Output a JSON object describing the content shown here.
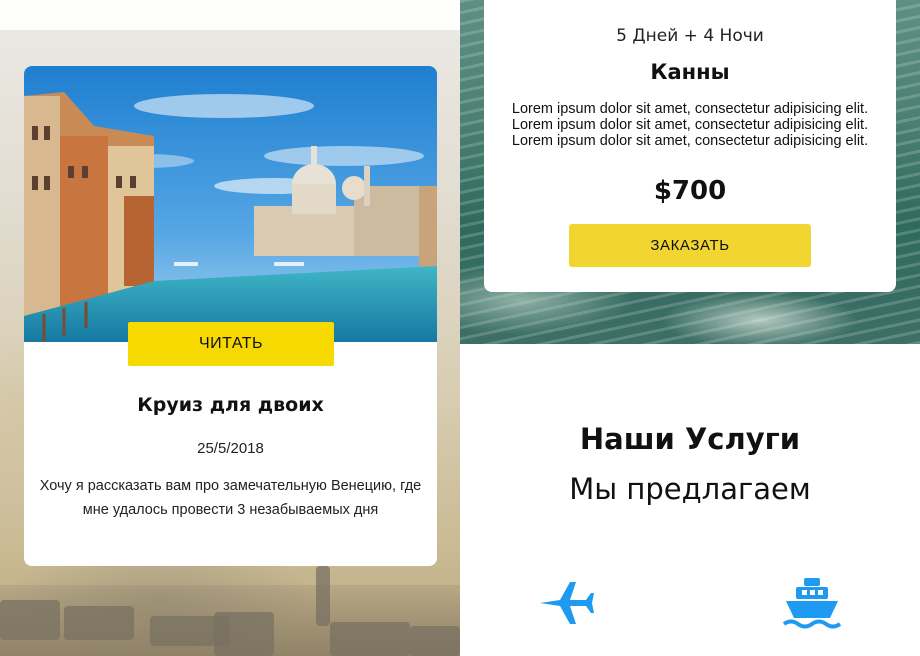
{
  "trip_card": {
    "read_button_label": "ЧИТАТЬ",
    "title": "Круиз для двоих",
    "date": "25/5/2018",
    "description": "Хочу я рассказать вам про замечательную Венецию, где мне удалось провести 3 незабываемых дня"
  },
  "tour_card": {
    "duration": "5 Дней + 4 Ночи",
    "city": "Канны",
    "description": "Lorem ipsum dolor sit amet, consectetur adipisicing elit. Lorem ipsum dolor sit amet, consectetur adipisicing elit. Lorem ipsum dolor sit amet, consectetur adipisicing elit.",
    "price": "$700",
    "order_button_label": "ЗАКАЗАТЬ"
  },
  "services": {
    "title": "Наши Услуги",
    "subtitle": "Мы предлагаем",
    "icons": [
      "airplane-icon",
      "ship-icon"
    ],
    "icon_color": "#1e9af0"
  },
  "colors": {
    "accent_yellow": "#f5d900",
    "text_dark": "#111111"
  }
}
